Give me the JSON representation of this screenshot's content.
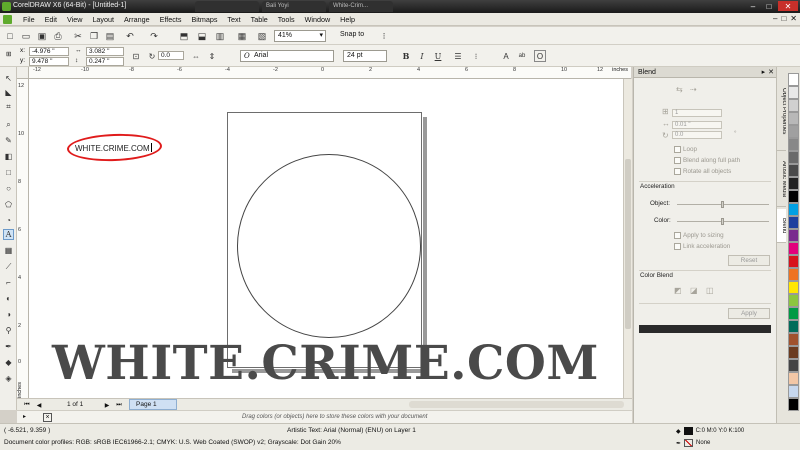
{
  "window": {
    "title": "CorelDRAW X6 (64-Bit) - [Untitled-1]",
    "background_tabs": [
      "",
      "Bali Yoyi",
      "White-Crim..."
    ],
    "minimize_glyph": "–",
    "maximize_glyph": "□",
    "close_glyph": "✕"
  },
  "menu": {
    "items": [
      "File",
      "Edit",
      "View",
      "Layout",
      "Arrange",
      "Effects",
      "Bitmaps",
      "Text",
      "Table",
      "Tools",
      "Window",
      "Help"
    ],
    "mdi_controls": [
      "–",
      "□",
      "✕"
    ]
  },
  "toolbar": {
    "zoom_level": "41%",
    "snap_to": "Snap to"
  },
  "property_bar": {
    "x_label": "x:",
    "x_value": "-4.976 \"",
    "y_label": "y:",
    "y_value": "9.478 \"",
    "width_value": "3.082 \"",
    "height_value": "0.247 \"",
    "rotation_value": "0.0",
    "font_name": "Arial",
    "font_size": "24 pt"
  },
  "ruler": {
    "unit": "inches",
    "h_ticks": [
      "-12",
      "-10",
      "-8",
      "-6",
      "-4",
      "-2",
      "0",
      "2",
      "4",
      "6",
      "8",
      "10",
      "12"
    ],
    "v_ticks": [
      "12",
      "10",
      "8",
      "6",
      "4",
      "2",
      "0"
    ]
  },
  "canvas": {
    "artistic_text": "WHITE.CRIME.COM",
    "watermark": "WHITE.CRIME.COM"
  },
  "pager": {
    "page_count": "1 of 1",
    "page_tab": "Page 1"
  },
  "color_dock": {
    "hint": "Drag colors (or objects) here to store these colors with your document"
  },
  "status_bar": {
    "cursor_position": "( -6.521, 9.359 )",
    "object_info": "Artistic Text: Arial (Normal) (ENU) on Layer 1",
    "color_profile": "Document color profiles: RGB: sRGB IEC61966-2.1; CMYK: U.S. Web Coated (SWOP) v2; Grayscale: Dot Gain 20%",
    "fill_value": "C:0 M:0 Y:0 K:100",
    "outline_value": "None"
  },
  "docker": {
    "title": "Blend",
    "steps_value": "1",
    "spacing_value": "0.01 \"",
    "rotation_value": "0.0",
    "rotation_unit": "°",
    "loop_label": "Loop",
    "blend_path_label": "Blend along full path",
    "rotate_all_label": "Rotate all objects",
    "acceleration_heading": "Acceleration",
    "object_label": "Object:",
    "color_label": "Color:",
    "apply_sizing_label": "Apply to sizing",
    "link_accel_label": "Link acceleration",
    "reset_label": "Reset",
    "color_blend_heading": "Color Blend",
    "apply_label": "Apply",
    "side_tabs": [
      "Object Properties",
      "Artistic Media",
      "Blend"
    ]
  },
  "palette": {
    "colors": [
      "#ffffff",
      "#e8e8e8",
      "#d0d0d0",
      "#b8b8b8",
      "#a0a0a0",
      "#888888",
      "#6a6a6a",
      "#4a4a4a",
      "#222222",
      "#000000",
      "#00a0e3",
      "#1d3f9e",
      "#7a2a8e",
      "#e3007c",
      "#d7131c",
      "#ee7322",
      "#ffe600",
      "#8cc63f",
      "#009a44",
      "#006c5a",
      "#a0522d",
      "#6b3b1f",
      "#444444",
      "#f2c7a6",
      "#c7d8ee",
      "#000000"
    ]
  }
}
